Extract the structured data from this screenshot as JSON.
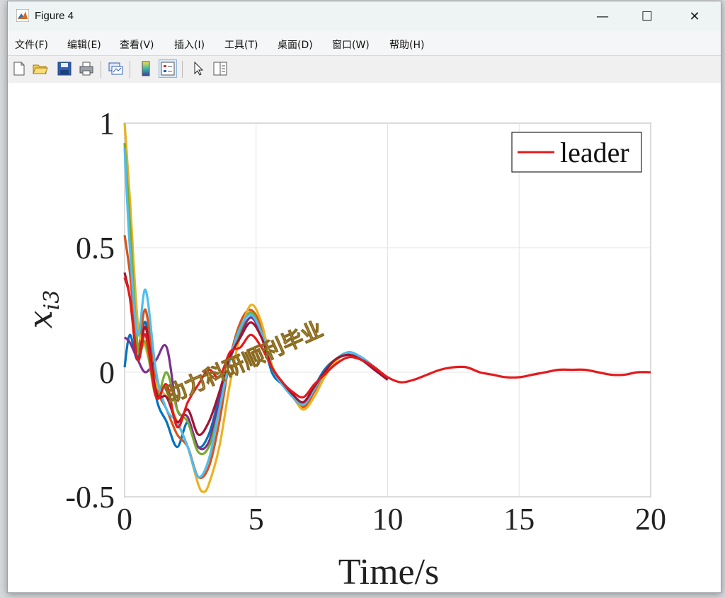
{
  "window": {
    "title": "Figure 4",
    "controls": {
      "minimize": "—",
      "maximize": "☐",
      "close": "✕"
    }
  },
  "menu": [
    "文件(F)",
    "编辑(E)",
    "查看(V)",
    "插入(I)",
    "工具(T)",
    "桌面(D)",
    "窗口(W)",
    "帮助(H)"
  ],
  "toolbar": {
    "buttons": [
      "new-figure-icon",
      "open-file-icon",
      "save-icon",
      "print-icon",
      "link-plot-icon",
      "colorbar-icon",
      "legend-icon",
      "pointer-icon",
      "property-inspector-icon"
    ],
    "active": "legend-icon"
  },
  "watermark": "助力科研顺利毕业",
  "chart_data": {
    "type": "line",
    "xlabel": "Time/s",
    "ylabel": "x_{i3}",
    "xlim": [
      0,
      20
    ],
    "ylim": [
      -0.5,
      1
    ],
    "xticks": [
      "0",
      "5",
      "10",
      "15",
      "20"
    ],
    "yticks": [
      "-0.5",
      "0",
      "0.5",
      "1"
    ],
    "grid": true,
    "legend": {
      "location": "top-right",
      "entries": [
        "leader"
      ]
    },
    "series": [
      {
        "name": "leader",
        "color": "#e41a1c",
        "x": [
          0,
          0.2,
          0.5,
          0.8,
          1.2,
          1.6,
          2.0,
          2.4,
          2.8,
          3.2,
          3.6,
          4.0,
          4.4,
          4.8,
          5.2,
          5.6,
          6.0,
          6.4,
          6.8,
          7.2,
          7.6,
          8.0,
          8.5,
          9.0,
          9.5,
          10.0,
          10.5,
          11.0,
          11.5,
          12.0,
          12.5,
          13.0,
          13.5,
          14.0,
          14.5,
          15.0,
          15.5,
          16.0,
          16.5,
          17.0,
          17.5,
          18.0,
          18.5,
          19.0,
          19.5,
          20.0
        ],
        "values": [
          0.38,
          0.3,
          0.05,
          0.15,
          -0.1,
          -0.05,
          -0.22,
          -0.12,
          -0.05,
          0.01,
          -0.02,
          0.08,
          0.1,
          0.15,
          0.1,
          0.02,
          -0.04,
          -0.08,
          -0.1,
          -0.05,
          -0.01,
          0.03,
          0.06,
          0.05,
          0.02,
          -0.02,
          -0.04,
          -0.03,
          -0.01,
          0.01,
          0.02,
          0.02,
          0.0,
          -0.01,
          -0.02,
          -0.02,
          -0.01,
          0.0,
          0.01,
          0.01,
          0.01,
          0.0,
          -0.01,
          -0.01,
          0.0,
          0.0
        ]
      },
      {
        "name": "",
        "color": "#0072bd",
        "x": [
          0,
          0.2,
          0.5,
          0.8,
          1.2,
          1.6,
          2.0,
          2.4,
          2.8,
          3.2,
          3.6,
          4.0,
          4.4,
          4.8,
          5.2,
          5.6,
          6.0,
          6.4,
          6.8,
          7.2,
          7.6,
          8.0,
          8.5,
          9.0,
          9.5,
          10.0
        ],
        "values": [
          0.02,
          0.15,
          0.05,
          0.2,
          -0.1,
          -0.2,
          -0.3,
          -0.2,
          -0.3,
          -0.25,
          -0.1,
          0.05,
          0.15,
          0.22,
          0.15,
          0.0,
          -0.05,
          -0.1,
          -0.12,
          -0.06,
          0.01,
          0.05,
          0.07,
          0.05,
          0.01,
          -0.03
        ]
      },
      {
        "name": "",
        "color": "#d95319",
        "x": [
          0,
          0.2,
          0.5,
          0.8,
          1.2,
          1.6,
          2.0,
          2.4,
          2.8,
          3.2,
          3.6,
          4.0,
          4.4,
          4.8,
          5.2,
          5.6,
          6.0,
          6.4,
          6.8,
          7.2,
          7.6,
          8.0,
          8.5,
          9.0,
          9.5,
          10.0
        ],
        "values": [
          0.55,
          0.4,
          0.1,
          0.25,
          -0.05,
          -0.15,
          -0.25,
          -0.3,
          -0.42,
          -0.38,
          -0.2,
          0.05,
          0.2,
          0.25,
          0.18,
          0.02,
          -0.04,
          -0.1,
          -0.14,
          -0.08,
          0.0,
          0.05,
          0.08,
          0.06,
          0.02,
          -0.03
        ]
      },
      {
        "name": "",
        "color": "#edb120",
        "x": [
          0,
          0.2,
          0.5,
          0.8,
          1.2,
          1.6,
          2.0,
          2.4,
          2.8,
          3.0,
          3.2,
          3.6,
          4.0,
          4.4,
          4.8,
          5.2,
          5.6,
          6.0,
          6.4,
          6.8,
          7.2,
          7.6,
          8.0,
          8.5,
          9.0,
          9.5,
          10.0
        ],
        "values": [
          1.0,
          0.7,
          0.2,
          0.1,
          -0.05,
          -0.1,
          -0.2,
          -0.3,
          -0.45,
          -0.48,
          -0.45,
          -0.3,
          -0.05,
          0.15,
          0.27,
          0.2,
          0.03,
          -0.05,
          -0.1,
          -0.15,
          -0.1,
          -0.02,
          0.04,
          0.08,
          0.06,
          0.02,
          -0.03
        ]
      },
      {
        "name": "",
        "color": "#7e2f8e",
        "x": [
          0,
          0.2,
          0.5,
          0.8,
          1.2,
          1.6,
          2.0,
          2.4,
          2.8,
          3.2,
          3.6,
          4.0,
          4.4,
          4.8,
          5.2,
          5.6,
          6.0,
          6.4,
          6.8,
          7.2,
          7.6,
          8.0,
          8.5,
          9.0,
          9.5,
          10.0
        ],
        "values": [
          0.14,
          0.12,
          0.05,
          0.0,
          0.05,
          0.1,
          -0.15,
          -0.18,
          -0.3,
          -0.28,
          -0.12,
          0.05,
          0.15,
          0.22,
          0.15,
          0.02,
          -0.04,
          -0.1,
          -0.13,
          -0.07,
          0.0,
          0.05,
          0.07,
          0.05,
          0.01,
          -0.03
        ]
      },
      {
        "name": "",
        "color": "#77ac30",
        "x": [
          0,
          0.2,
          0.5,
          0.8,
          1.2,
          1.6,
          2.0,
          2.4,
          2.8,
          3.2,
          3.6,
          4.0,
          4.4,
          4.8,
          5.2,
          5.6,
          6.0,
          6.4,
          6.8,
          7.2,
          7.6,
          8.0,
          8.5,
          9.0,
          9.5,
          10.0
        ],
        "values": [
          0.92,
          0.6,
          0.1,
          0.12,
          -0.1,
          0.0,
          -0.15,
          -0.2,
          -0.32,
          -0.3,
          -0.15,
          0.05,
          0.17,
          0.24,
          0.16,
          0.02,
          -0.05,
          -0.1,
          -0.13,
          -0.07,
          0.0,
          0.05,
          0.08,
          0.06,
          0.02,
          -0.03
        ]
      },
      {
        "name": "",
        "color": "#4dbeee",
        "x": [
          0,
          0.2,
          0.5,
          0.8,
          1.2,
          1.6,
          2.0,
          2.4,
          2.8,
          3.2,
          3.6,
          4.0,
          4.4,
          4.8,
          5.2,
          5.6,
          6.0,
          6.4,
          6.8,
          7.2,
          7.6,
          8.0,
          8.5,
          9.0,
          9.5,
          10.0
        ],
        "values": [
          0.9,
          0.5,
          0.15,
          0.33,
          0.0,
          -0.15,
          -0.2,
          -0.3,
          -0.42,
          -0.35,
          -0.15,
          0.05,
          0.18,
          0.23,
          0.16,
          0.02,
          -0.05,
          -0.1,
          -0.13,
          -0.07,
          0.0,
          0.05,
          0.08,
          0.06,
          0.02,
          -0.03
        ]
      },
      {
        "name": "",
        "color": "#a2142f",
        "x": [
          0,
          0.2,
          0.5,
          0.8,
          1.2,
          1.6,
          2.0,
          2.4,
          2.8,
          3.2,
          3.6,
          4.0,
          4.4,
          4.8,
          5.2,
          5.6,
          6.0,
          6.4,
          6.8,
          7.2,
          7.6,
          8.0,
          8.5,
          9.0,
          9.5,
          10.0
        ],
        "values": [
          0.4,
          0.3,
          0.05,
          0.18,
          -0.08,
          -0.1,
          -0.2,
          -0.15,
          -0.25,
          -0.2,
          -0.08,
          0.06,
          0.14,
          0.2,
          0.14,
          0.02,
          -0.04,
          -0.09,
          -0.12,
          -0.06,
          0.0,
          0.05,
          0.07,
          0.05,
          0.01,
          -0.03
        ]
      }
    ]
  }
}
